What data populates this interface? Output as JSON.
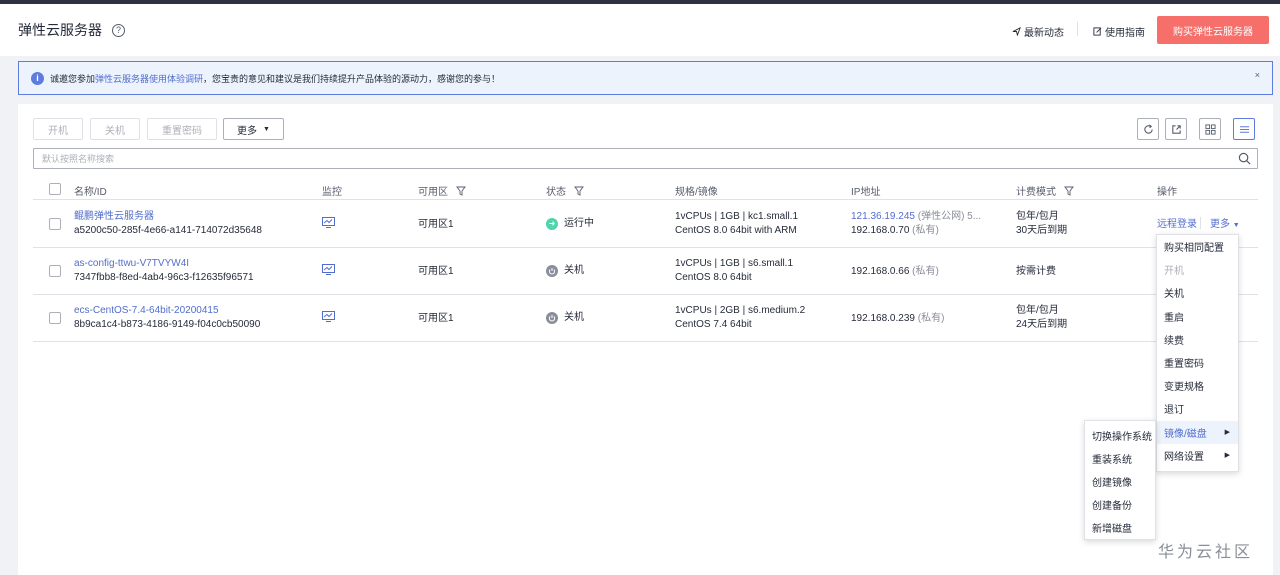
{
  "header": {
    "title": "弹性云服务器",
    "help_glyph": "?",
    "news_label": "最新动态",
    "guide_label": "使用指南",
    "buy_label": "购买弹性云服务器"
  },
  "notice": {
    "prefix": "诚邀您参加",
    "link": "弹性云服务器使用体验调研",
    "suffix": "，您宝贵的意见和建议是我们持续提升产品体验的源动力，感谢您的参与！",
    "close": "×"
  },
  "toolbar": {
    "start": "开机",
    "stop": "关机",
    "reset_password": "重置密码",
    "more": "更多"
  },
  "search": {
    "placeholder": "默认按照名称搜索"
  },
  "columns": {
    "name": "名称/ID",
    "monitor": "监控",
    "zone": "可用区",
    "status": "状态",
    "spec": "规格/镜像",
    "ip": "IP地址",
    "billing": "计费模式",
    "action": "操作"
  },
  "rows": [
    {
      "name": "鲲鹏弹性云服务器",
      "id": "a5200c50-285f-4e66-a141-714072d35648",
      "zone": "可用区1",
      "status": "运行中",
      "spec": "1vCPUs | 1GB | kc1.small.1",
      "image": "CentOS 8.0 64bit with ARM",
      "ip_public": "121.36.19.245",
      "ip_public_tag": "(弹性公网) 5...",
      "ip_private": "192.168.0.70",
      "ip_private_tag": "(私有)",
      "billing": "包年/包月",
      "billing_sub": "30天后到期",
      "action_login": "远程登录",
      "action_more": "更多"
    },
    {
      "name": "as-config-ttwu-V7TVYW4I",
      "id": "7347fbb8-f8ed-4ab4-96c3-f12635f96571",
      "zone": "可用区1",
      "status": "关机",
      "spec": "1vCPUs | 1GB | s6.small.1",
      "image": "CentOS 8.0 64bit",
      "ip_private": "192.168.0.66",
      "ip_private_tag": "(私有)",
      "billing": "按需计费"
    },
    {
      "name": "ecs-CentOS-7.4-64bit-20200415",
      "id": "8b9ca1c4-b873-4186-9149-f04c0cb50090",
      "zone": "可用区1",
      "status": "关机",
      "spec": "1vCPUs | 2GB | s6.medium.2",
      "image": "CentOS 7.4 64bit",
      "ip_private": "192.168.0.239",
      "ip_private_tag": "(私有)",
      "billing": "包年/包月",
      "billing_sub": "24天后到期"
    }
  ],
  "more_menu": {
    "items": [
      "购买相同配置",
      "开机",
      "关机",
      "重启",
      "续费",
      "重置密码",
      "变更规格",
      "退订",
      "镜像/磁盘",
      "网络设置"
    ]
  },
  "submenu": {
    "items": [
      "切换操作系统",
      "重装系统",
      "创建镜像",
      "创建备份",
      "新增磁盘"
    ]
  },
  "watermark": "华为云社区",
  "colors": {
    "accent": "#526ecc",
    "buy_button": "#f66f6a",
    "running": "#50d4ab"
  }
}
